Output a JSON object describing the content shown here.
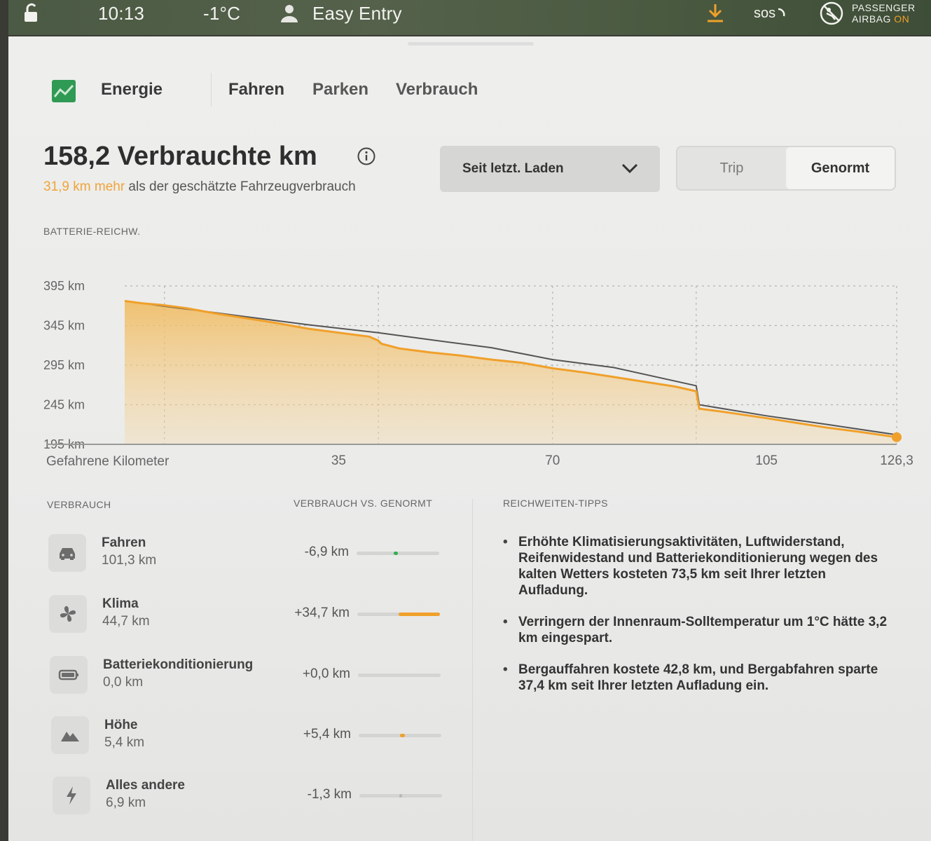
{
  "status_bar": {
    "time": "10:13",
    "temperature": "-1°C",
    "profile": "Easy Entry",
    "sos": "sos",
    "airbag_line1": "PASSENGER",
    "airbag_line2": "AIRBAG",
    "airbag_state": "ON",
    "icons": [
      "unlock-icon",
      "person-icon",
      "download-icon",
      "sos-icon",
      "airbag-icon"
    ],
    "accent_color": "#f0a02a"
  },
  "tabs": {
    "energy": "Energie",
    "items": [
      {
        "label": "Fahren",
        "active": true
      },
      {
        "label": "Parken",
        "active": false
      },
      {
        "label": "Verbrauch",
        "active": false
      }
    ]
  },
  "summary": {
    "title": "158,2 Verbrauchte km",
    "delta": "31,9 km mehr",
    "delta_rest": " als der geschätzte Fahrzeugverbrauch",
    "delta_color": "#f0a43a"
  },
  "range_select": {
    "selected": "Seit letzt. Laden"
  },
  "toggle": {
    "trip": "Trip",
    "genormt": "Genormt",
    "active": "Genormt"
  },
  "chart_data": {
    "type": "area",
    "title": "BATTERIE-REICHW.",
    "xlabel": "Gefahrene Kilometer",
    "ylabel": "",
    "x_ticks": [
      "35",
      "70",
      "105",
      "126,3"
    ],
    "y_ticks": [
      "395 km",
      "345 km",
      "295 km",
      "245 km",
      "195 km"
    ],
    "y_tick_values": [
      395,
      345,
      295,
      245,
      195
    ],
    "xlim": [
      0,
      126.3
    ],
    "ylim": [
      145,
      405
    ],
    "grid": true,
    "series": [
      {
        "kind": "actual",
        "color": "#f0a02a",
        "x": [
          0,
          3,
          6,
          10,
          15,
          20,
          25,
          30,
          35,
          40,
          41.5,
          42,
          45,
          50,
          55,
          60,
          65,
          70,
          75,
          80,
          85,
          90,
          93.5,
          94,
          98,
          105,
          110,
          115,
          120,
          126.3
        ],
        "y": [
          376,
          373,
          371,
          367,
          360,
          354,
          348,
          341,
          336,
          331,
          326,
          322,
          316,
          311,
          307,
          302,
          298,
          291,
          286,
          280,
          274,
          268,
          262,
          240,
          236,
          228,
          222,
          216,
          211,
          204
        ]
      },
      {
        "kind": "genormt",
        "color": "#555555",
        "x": [
          0,
          10,
          20,
          30,
          41.5,
          50,
          60,
          70,
          80,
          93.5,
          94,
          105,
          115,
          126.3
        ],
        "y": [
          376,
          366,
          356,
          346,
          336,
          327,
          317,
          302,
          292,
          269,
          245,
          231,
          220,
          207
        ]
      }
    ],
    "vertical_markers_km": [
      6.5,
      41.5,
      70,
      93.5
    ]
  },
  "consumption": {
    "head_left": "VERBRAUCH",
    "head_mid": "VERBRAUCH VS. GENORMT",
    "items": [
      {
        "icon": "car-icon",
        "title": "Fahren",
        "value": "101,3 km",
        "delta": "-6,9 km",
        "bar_pos": 0.45,
        "bar_len": 0.05,
        "bar_color": "#2fb04f"
      },
      {
        "icon": "fan-icon",
        "title": "Klima",
        "value": "44,7 km",
        "delta": "+34,7 km",
        "bar_pos": 0.5,
        "bar_len": 0.5,
        "bar_color": "#f0a02a"
      },
      {
        "icon": "battery-icon",
        "title": "Batteriekonditionierung",
        "value": "0,0 km",
        "delta": "+0,0 km",
        "bar_pos": 0.5,
        "bar_len": 0.0,
        "bar_color": "#f0a02a"
      },
      {
        "icon": "mountain-icon",
        "title": "Höhe",
        "value": "5,4 km",
        "delta": "+5,4 km",
        "bar_pos": 0.5,
        "bar_len": 0.06,
        "bar_color": "#f0a02a"
      },
      {
        "icon": "bolt-icon",
        "title": "Alles andere",
        "value": "6,9 km",
        "delta": "-1,3 km",
        "bar_pos": 0.48,
        "bar_len": 0.02,
        "bar_color": "#b9b9b7"
      }
    ]
  },
  "tips": {
    "head": "REICHWEITEN-TIPPS",
    "items": [
      "Erhöhte Klimatisierungsaktivitäten, Luftwiderstand, Reifenwidestand und Batteriekonditionierung wegen des kalten Wetters kosteten 73,5 km seit Ihrer letzten Aufladung.",
      "Verringern der Innenraum-Solltemperatur um 1°C hätte 3,2 km eingespart.",
      "Bergauffahren kostete 42,8 km, und Bergabfahren sparte 37,4 km seit Ihrer letzten Aufladung ein."
    ]
  }
}
